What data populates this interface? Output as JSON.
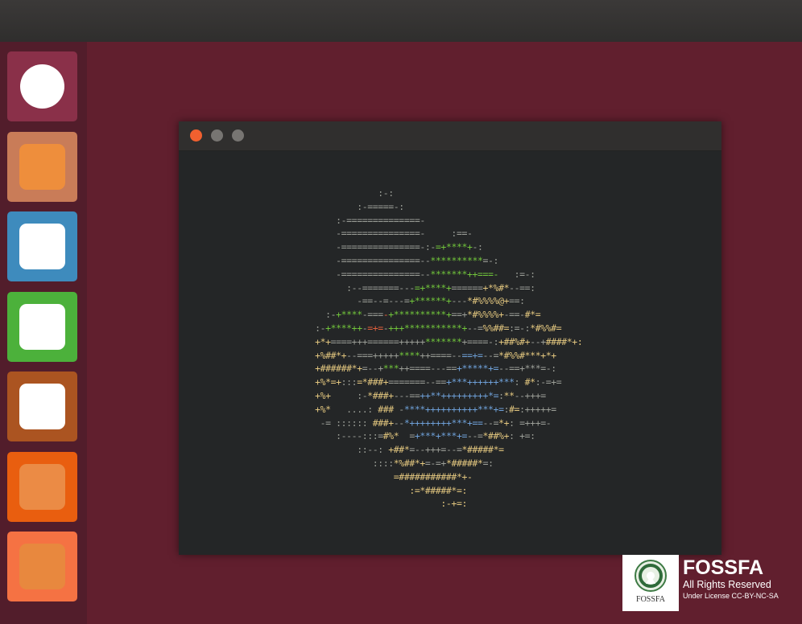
{
  "launcher": {
    "items": [
      {
        "name": "launcher-item-1",
        "bg": "#8a3049",
        "inner": "circle",
        "innerColor": "#ffffff"
      },
      {
        "name": "launcher-item-2",
        "bg": "#c97c58",
        "inner": "square",
        "innerColor": "#ee8e3c"
      },
      {
        "name": "launcher-item-3",
        "bg": "#3e8bbd",
        "inner": "square",
        "innerColor": "#ffffff"
      },
      {
        "name": "launcher-item-4",
        "bg": "#4cb13b",
        "inner": "square",
        "innerColor": "#ffffff"
      },
      {
        "name": "launcher-item-5",
        "bg": "#ab5421",
        "inner": "square",
        "innerColor": "#ffffff"
      },
      {
        "name": "launcher-item-6",
        "bg": "#e95e0f",
        "inner": "square",
        "innerColor": "#eb8b45"
      },
      {
        "name": "launcher-item-7",
        "bg": "#f57243",
        "inner": "square",
        "innerColor": "#e8883e"
      }
    ]
  },
  "window": {
    "buttons": {
      "close": "#f2602f",
      "minimize": "#777572",
      "maximize": "#777572"
    }
  },
  "terminal": {
    "ascii_art": [
      [
        [
          "g",
          "                  :-:"
        ]
      ],
      [
        [
          "g",
          "              :-=====-:"
        ]
      ],
      [
        [
          "g",
          "          :-==============-"
        ]
      ],
      [
        [
          "g",
          "          -===============-     :==-"
        ]
      ],
      [
        [
          "g",
          "          -===============-:-"
        ],
        [
          "gr",
          "=+****+"
        ],
        [
          "g",
          "-:"
        ]
      ],
      [
        [
          "g",
          "          -===============--"
        ],
        [
          "gr",
          "**********"
        ],
        [
          "g",
          "=-:"
        ]
      ],
      [
        [
          "g",
          "          -===============--"
        ],
        [
          "gr",
          "*******++===-"
        ],
        [
          "g",
          "   :=-:"
        ]
      ],
      [
        [
          "g",
          "            :--=======---"
        ],
        [
          "gr",
          "=+****+"
        ],
        [
          "g",
          "======"
        ],
        [
          "y",
          "+*%#*"
        ],
        [
          "g",
          "--==:"
        ]
      ],
      [
        [
          "g",
          "              -==--=---="
        ],
        [
          "gr",
          "+******+"
        ],
        [
          "g",
          "---"
        ],
        [
          "y",
          "*#%%%%@+"
        ],
        [
          "g",
          "==:"
        ]
      ],
      [
        [
          "g",
          "        :-"
        ],
        [
          "gr",
          "+****"
        ],
        [
          "g",
          "-==="
        ],
        [
          "r",
          "-"
        ],
        [
          "gr",
          "+**********+"
        ],
        [
          "g",
          "==+"
        ],
        [
          "y",
          "*#%%%%+"
        ],
        [
          "g",
          "-==-"
        ],
        [
          "y",
          "#*="
        ]
      ],
      [
        [
          "g",
          "      :-"
        ],
        [
          "gr",
          "+****++"
        ],
        [
          "g",
          "-"
        ],
        [
          "r",
          "=+="
        ],
        [
          "g",
          "-"
        ],
        [
          "gr",
          "+++***********+"
        ],
        [
          "g",
          "--="
        ],
        [
          "y",
          "%%##="
        ],
        [
          "g",
          ":=-:"
        ],
        [
          "y",
          "*#%%#="
        ]
      ],
      [
        [
          "y",
          "      +*+"
        ],
        [
          "g",
          "====+++======+++++"
        ],
        [
          "gr",
          "*******"
        ],
        [
          "g",
          "+====-:"
        ],
        [
          "y",
          "+##%#+"
        ],
        [
          "g",
          "--+"
        ],
        [
          "y",
          "####*+:"
        ]
      ],
      [
        [
          "y",
          "      +%##*+"
        ],
        [
          "g",
          "--===+++++"
        ],
        [
          "gr",
          "****"
        ],
        [
          "g",
          "++====--"
        ],
        [
          "b",
          "==+="
        ],
        [
          "g",
          "--="
        ],
        [
          "y",
          "*#%%#***+*+"
        ]
      ],
      [
        [
          "y",
          "      +######*+"
        ],
        [
          "g",
          "=--+"
        ],
        [
          "gr",
          "***"
        ],
        [
          "g",
          "++====---=="
        ],
        [
          "b",
          "+*****+="
        ],
        [
          "g",
          "--==+***=-:"
        ]
      ],
      [
        [
          "y",
          "      +%*=+"
        ],
        [
          "g",
          ":::"
        ],
        [
          "y",
          "=*###+"
        ],
        [
          "g",
          "=======--=="
        ],
        [
          "b",
          "+***++++++***"
        ],
        [
          "g",
          ":"
        ],
        [
          "y",
          " #*"
        ],
        [
          "g",
          ":-=+="
        ]
      ],
      [
        [
          "y",
          "      +%+"
        ],
        [
          "g",
          "     :-"
        ],
        [
          "y",
          "*###+"
        ],
        [
          "g",
          "---=="
        ],
        [
          "b",
          "++**+++++++++*="
        ],
        [
          "g",
          ":"
        ],
        [
          "y",
          "**"
        ],
        [
          "g",
          "--+++="
        ]
      ],
      [
        [
          "y",
          "      +%*"
        ],
        [
          "g",
          "   ....:"
        ],
        [
          "y",
          " ###"
        ],
        [
          "g",
          " -"
        ],
        [
          "b",
          "****++++++++++***+="
        ],
        [
          "g",
          ":"
        ],
        [
          "y",
          "#="
        ],
        [
          "g",
          ":+++++="
        ]
      ],
      [
        [
          "g",
          "       -= :::::: "
        ],
        [
          "y",
          "###+"
        ],
        [
          "g",
          "--"
        ],
        [
          "b",
          "*++++++++***+=="
        ],
        [
          "g",
          "--="
        ],
        [
          "y",
          "*+"
        ],
        [
          "g",
          ": =+++=-"
        ]
      ],
      [
        [
          "g",
          "          :----:::="
        ],
        [
          "y",
          "#%*"
        ],
        [
          "g",
          "  ="
        ],
        [
          "b",
          "+***+***+="
        ],
        [
          "g",
          "--="
        ],
        [
          "y",
          "*##%+"
        ],
        [
          "g",
          ": +=:"
        ]
      ],
      [
        [
          "g",
          "              ::--: "
        ],
        [
          "y",
          "+##*"
        ],
        [
          "g",
          "=--+++=--="
        ],
        [
          "y",
          "*#####*="
        ]
      ],
      [
        [
          "g",
          "                 ::::"
        ],
        [
          "y",
          "*%##*+"
        ],
        [
          "g",
          "=-=+"
        ],
        [
          "y",
          "*#####*"
        ],
        [
          "g",
          "=:"
        ]
      ],
      [
        [
          "y",
          "                     =###########*+-"
        ]
      ],
      [
        [
          "y",
          "                        :=*#####*=:"
        ]
      ],
      [
        [
          "y",
          "                              :-+=:"
        ]
      ]
    ]
  },
  "watermark": {
    "logo_text": "FOSSFA",
    "brand": "FOSSFA",
    "rights": "All Rights Reserved",
    "license": "Under License CC-BY-NC-SA"
  }
}
